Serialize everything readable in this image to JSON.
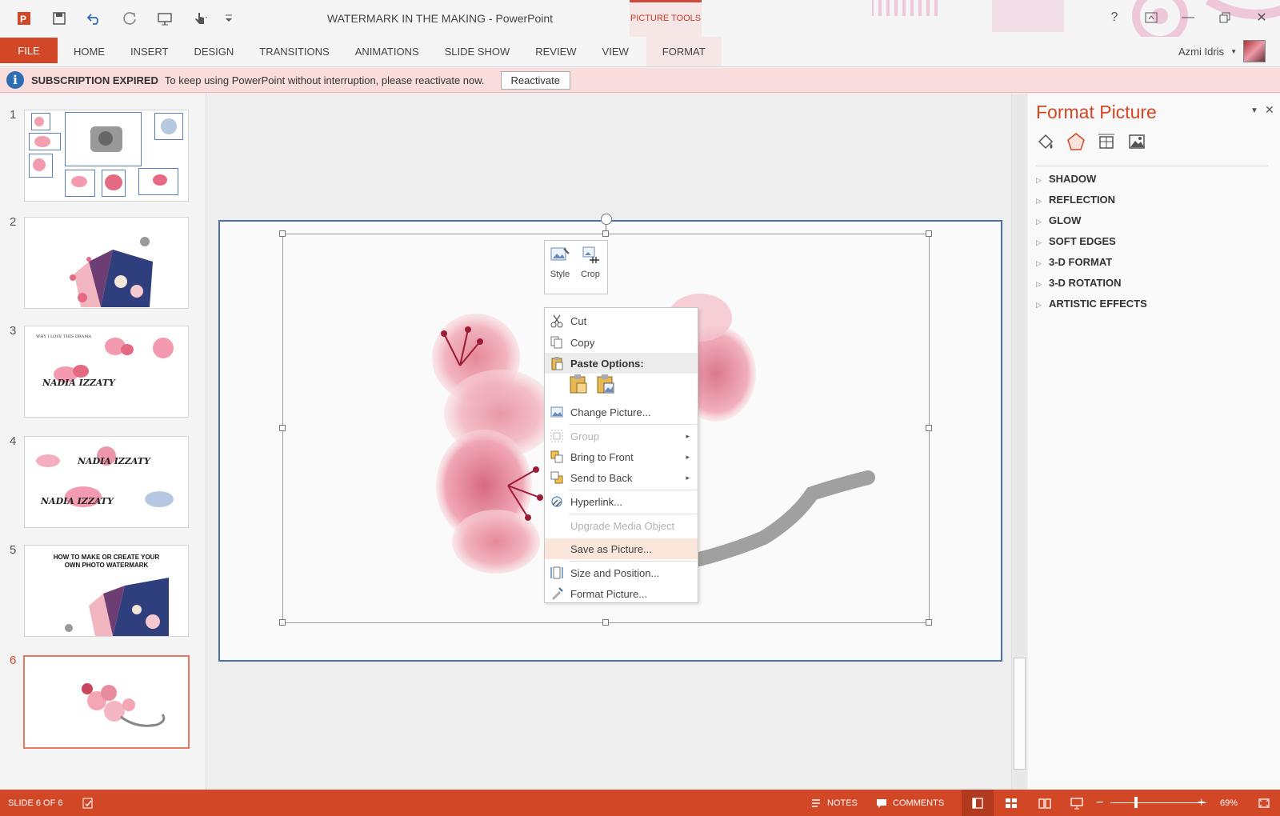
{
  "window": {
    "title": "WATERMARK IN THE MAKING - PowerPoint",
    "contextual_group": "PICTURE TOOLS"
  },
  "ribbon": {
    "file": "FILE",
    "tabs": [
      "HOME",
      "INSERT",
      "DESIGN",
      "TRANSITIONS",
      "ANIMATIONS",
      "SLIDE SHOW",
      "REVIEW",
      "VIEW"
    ],
    "format_tab": "FORMAT",
    "user_name": "Azmi Idris"
  },
  "message_bar": {
    "title": "SUBSCRIPTION EXPIRED",
    "text": "To keep using PowerPoint without interruption, please reactivate now.",
    "button": "Reactivate"
  },
  "thumbnails": {
    "numbers": [
      "1",
      "2",
      "3",
      "4",
      "5",
      "6"
    ],
    "slide3_text_top": "WHY I LOVE THIS DRAMA",
    "slide3_text": "NADIA IZZATY",
    "slide4_text": "NADIA IZZATY",
    "slide4_text2": "NADIA IZZATY",
    "slide5_title": "HOW TO MAKE OR CREATE YOUR OWN PHOTO WATERMARK",
    "active_index": 6
  },
  "mini_toolbar": {
    "style": "Style",
    "crop": "Crop"
  },
  "context_menu": {
    "cut": "Cut",
    "copy": "Copy",
    "paste_options": "Paste Options:",
    "change_picture": "Change Picture...",
    "group": "Group",
    "bring_to_front": "Bring to Front",
    "send_to_back": "Send to Back",
    "hyperlink": "Hyperlink...",
    "upgrade_media": "Upgrade Media Object",
    "save_as_picture": "Save as Picture...",
    "size_position": "Size and Position...",
    "format_picture": "Format Picture..."
  },
  "format_panel": {
    "title": "Format Picture",
    "items": [
      "SHADOW",
      "REFLECTION",
      "GLOW",
      "SOFT EDGES",
      "3-D FORMAT",
      "3-D ROTATION",
      "ARTISTIC EFFECTS"
    ]
  },
  "status_bar": {
    "slide_info": "SLIDE 6 OF 6",
    "notes": "NOTES",
    "comments": "COMMENTS",
    "zoom": "69%"
  },
  "colors": {
    "accent": "#d24726",
    "message_bar": "#f9dcdc",
    "selection_border": "#4a6fae"
  }
}
